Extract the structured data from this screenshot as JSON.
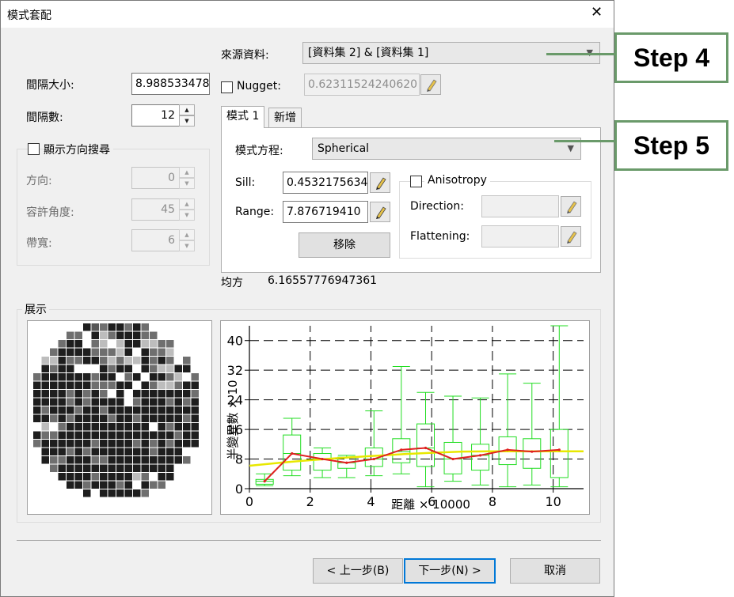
{
  "window": {
    "title": "模式套配",
    "close_label": "✕"
  },
  "source": {
    "label": "來源資料:",
    "value": "[資料集 2] & [資料集 1]"
  },
  "interval": {
    "size_label": "間隔大小:",
    "size_value": "8.988533478",
    "count_label": "間隔數:",
    "count_value": "12"
  },
  "direction_search": {
    "checkbox_label": "顯示方向搜尋",
    "direction_label": "方向:",
    "direction_value": "0",
    "tolerance_label": "容許角度:",
    "tolerance_value": "45",
    "bandwidth_label": "帶寬:",
    "bandwidth_value": "6"
  },
  "nugget": {
    "label": "Nugget:",
    "value": "0.62311524240620"
  },
  "tabs": [
    {
      "label": "模式 1"
    },
    {
      "label": "新增"
    }
  ],
  "model": {
    "equation_label": "模式方程:",
    "equation_value": "Spherical",
    "sill_label": "Sill:",
    "sill_value": "0.4532175634",
    "range_label": "Range:",
    "range_value": "7.876719410",
    "remove_label": "移除",
    "anisotropy_label": "Anisotropy",
    "direction_label": "Direction:",
    "flattening_label": "Flattening:"
  },
  "mse": {
    "label": "均方",
    "value": "6.16557776947361"
  },
  "display": {
    "label": "展示"
  },
  "chart_data": {
    "type": "box",
    "xlabel": "距離 × 10000",
    "ylabel": "半變異數 × 10",
    "xlim": [
      0,
      11
    ],
    "ylim": [
      0,
      44
    ],
    "xticks": [
      0,
      2,
      4,
      6,
      8,
      10
    ],
    "yticks": [
      0,
      8,
      16,
      24,
      32,
      40
    ],
    "grid": "dashed",
    "boxes": [
      {
        "x": 0.5,
        "min": 0.8,
        "q1": 1.2,
        "median": 2,
        "q3": 2.5,
        "max": 4
      },
      {
        "x": 1.4,
        "min": 3.5,
        "q1": 5,
        "median": 9.5,
        "q3": 14.5,
        "max": 19
      },
      {
        "x": 2.4,
        "min": 3,
        "q1": 5,
        "median": 8,
        "q3": 9.5,
        "max": 11
      },
      {
        "x": 3.2,
        "min": 3,
        "q1": 5.5,
        "median": 7,
        "q3": 8.5,
        "max": 9
      },
      {
        "x": 4.1,
        "min": 3.5,
        "q1": 6,
        "median": 8,
        "q3": 11,
        "max": 21
      },
      {
        "x": 5,
        "min": 4,
        "q1": 7,
        "median": 10,
        "q3": 13.5,
        "max": 33
      },
      {
        "x": 5.8,
        "min": 0.5,
        "q1": 6,
        "median": 11,
        "q3": 17.5,
        "max": 26
      },
      {
        "x": 6.7,
        "min": 2,
        "q1": 4,
        "median": 8,
        "q3": 12.5,
        "max": 25
      },
      {
        "x": 7.6,
        "min": 1,
        "q1": 5,
        "median": 9,
        "q3": 12,
        "max": 24.5
      },
      {
        "x": 8.5,
        "min": 0.5,
        "q1": 6.5,
        "median": 10,
        "q3": 14,
        "max": 31
      },
      {
        "x": 9.3,
        "min": 1,
        "q1": 5.5,
        "median": 10,
        "q3": 13.5,
        "max": 28.5
      },
      {
        "x": 10.2,
        "min": 0.5,
        "q1": 3,
        "median": 10,
        "q3": 16,
        "max": 44
      }
    ],
    "empirical": {
      "color": "#e02020",
      "x": [
        0.5,
        1.4,
        2.4,
        3.2,
        4.1,
        5,
        5.8,
        6.7,
        7.6,
        8.5,
        9.3,
        10.2
      ],
      "y": [
        2,
        9.5,
        8,
        7,
        8,
        10.5,
        11,
        8,
        9,
        10.5,
        10,
        10.5
      ]
    },
    "model_curve": {
      "color": "#e8e800",
      "x": [
        0,
        1,
        2,
        3,
        4,
        5,
        6,
        7,
        7.9,
        9,
        10,
        11
      ],
      "y": [
        6.2,
        7,
        7.7,
        8.3,
        8.8,
        9.3,
        9.7,
        10,
        10.1,
        10.1,
        10.1,
        10.1
      ]
    },
    "box_color": "#22dd22"
  },
  "buttons": {
    "back_label": "< 上一步(B)",
    "next_label": "下一步(N) >",
    "cancel_label": "取消"
  },
  "callouts": [
    {
      "label": "Step 4"
    },
    {
      "label": "Step 5"
    }
  ],
  "preview": {
    "rows": [
      {
        "start": 6,
        "cells": "37233232"
      },
      {
        "start": 4,
        "cells": "220312333220"
      },
      {
        "start": 3,
        "cells": "23302101331122"
      },
      {
        "start": 2,
        "cells": "2333322213032210"
      },
      {
        "start": 1,
        "cells": "113223321211323202"
      },
      {
        "start": 1,
        "cells": "323300032330321133"
      },
      {
        "start": 0,
        "cells": "23333332330230332102"
      },
      {
        "start": 0,
        "cells": "33333332223303211233"
      },
      {
        "start": 0,
        "cells": "33332323203033333332"
      },
      {
        "start": 0,
        "cells": "33332323333023332323"
      },
      {
        "start": 0,
        "cells": "32333233233333333333"
      },
      {
        "start": 0,
        "cells": "33232333323323333323"
      },
      {
        "start": 0,
        "cells": "01023333333333032333"
      },
      {
        "start": 0,
        "cells": "32233333333333333233"
      },
      {
        "start": 0,
        "cells": "23333332333323232333"
      },
      {
        "start": 1,
        "cells": "333232333333323330"
      },
      {
        "start": 1,
        "cells": "322333223333333332"
      },
      {
        "start": 2,
        "cells": "2333333333333330"
      },
      {
        "start": 3,
        "cells": "33332333312033"
      },
      {
        "start": 4,
        "cells": "332333230322"
      },
      {
        "start": 6,
        "cells": "30333332"
      }
    ]
  }
}
